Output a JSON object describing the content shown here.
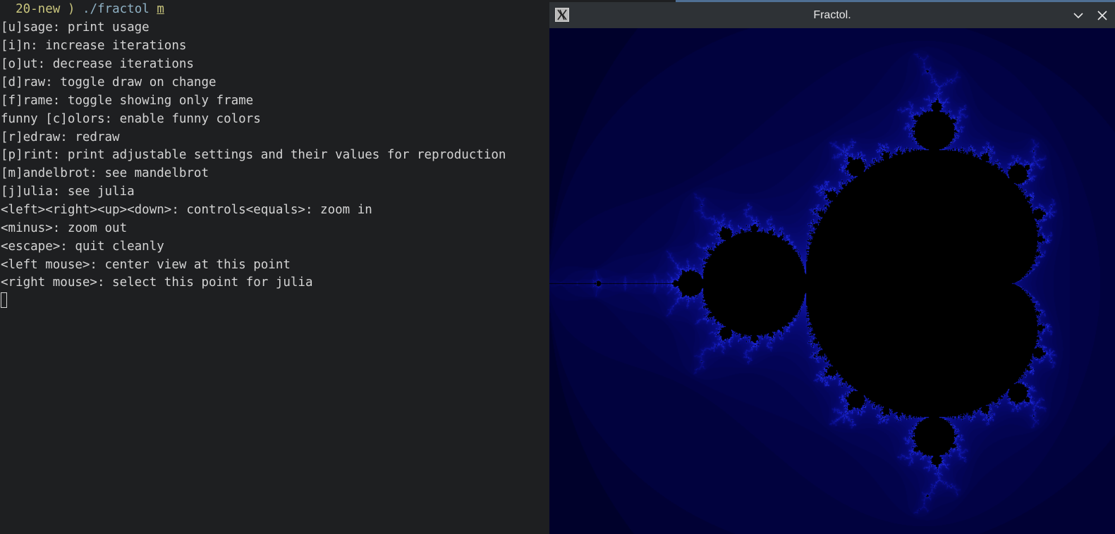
{
  "terminal": {
    "prompt": {
      "dir": "20-new",
      "separator": ")",
      "command": "./fractol",
      "argument": "m"
    },
    "lines": [
      "[u]sage: print usage",
      "[i]n: increase iterations",
      "[o]ut: decrease iterations",
      "[d]raw: toggle draw on change",
      "[f]rame: toggle showing only frame",
      "funny [c]olors: enable funny colors",
      "[r]edraw: redraw",
      "[p]rint: print adjustable settings and their values for reproduction",
      "[m]andelbrot: see mandelbrot",
      "[j]ulia: see julia",
      "<left><right><up><down>: controls<equals>: zoom in",
      "<minus>: zoom out",
      "<escape>: quit cleanly",
      "<left mouse>: center view at this point",
      "<right mouse>: select this point for julia"
    ]
  },
  "window": {
    "title": "Fractol.",
    "app_icon": "x11-icon",
    "minimize_icon": "chevron-down-icon",
    "close_icon": "close-icon"
  },
  "fractal": {
    "type": "mandelbrot",
    "colors": {
      "set": "#000000",
      "edge": "#2a3cff",
      "glow": "#0a10a0"
    }
  }
}
